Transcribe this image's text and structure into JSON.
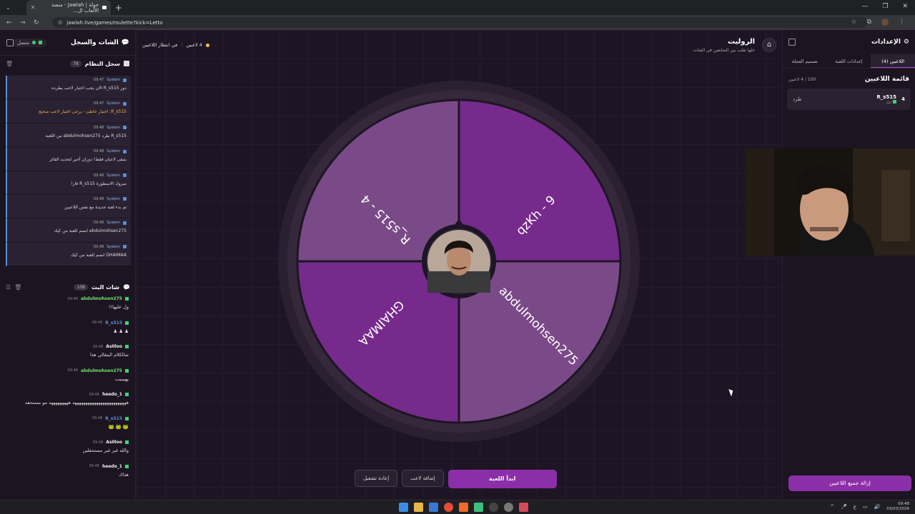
{
  "browser": {
    "tab_title": "جولة | Jawlah - منصة الألعاب ال...",
    "url": "jawlah.live/games/roulette?kick=Letto"
  },
  "left_panel": {
    "title": "الشات والسجل",
    "status": "متصل",
    "system_log": {
      "title": "سجل النظام",
      "count": "78",
      "items": [
        {
          "time": "09:47",
          "sender": "System",
          "text": "دور R_s515 الان يجب اختيار لاعب يطرده",
          "warn": false
        },
        {
          "time": "09:47",
          "sender": "System",
          "text": "R_s515: اختيار خاطئ - يرجى اختيار لاعب صحيح",
          "warn": true
        },
        {
          "time": "09:48",
          "sender": "System",
          "text": "R_s515 طرد abdulmohsen275 من اللعبة",
          "warn": false
        },
        {
          "time": "09:48",
          "sender": "System",
          "text": "بتبقى لاعبان فقط! دوران أخير لتحديد الفائز",
          "warn": false
        },
        {
          "time": "09:48",
          "sender": "System",
          "text": "مبروك الاسطورة R_s515 فاز!",
          "warn": false
        },
        {
          "time": "09:48",
          "sender": "System",
          "text": "تم بدء لعبة جديدة مع نفس اللاعبين",
          "warn": false
        },
        {
          "time": "09:48",
          "sender": "System",
          "text": "abdulmohsen275 انضم للعبة من كيك",
          "warn": false
        },
        {
          "time": "09:48",
          "sender": "System",
          "text": "GHAIMAA انضم للعبة من كيك",
          "warn": false
        }
      ]
    },
    "live_chat": {
      "title": "شات البث",
      "count": "108",
      "messages": [
        {
          "time": "09:48",
          "user": "abdulmohsen275",
          "color": "#6fe36a",
          "text": "ول عليها!!"
        },
        {
          "time": "09:48",
          "user": "R_s515",
          "color": "#5b8fd6",
          "text": "♟ ♟ ♟"
        },
        {
          "time": "09:48",
          "user": "As0loo",
          "color": "#f0f0f0",
          "text": "شالكلام البتقالي هذا"
        },
        {
          "time": "09:48",
          "user": "abdulmohsen275",
          "color": "#6fe36a",
          "text": "يهببببب"
        },
        {
          "time": "09:48",
          "user": "heedo_1",
          "color": "#f0f0f0",
          "text": "هههههههههههههههههههههههههه هههههههههه مو مستحقه"
        },
        {
          "time": "09:48",
          "user": "R_s515",
          "color": "#5b8fd6",
          "text": "🐸 🐸 🐸"
        },
        {
          "time": "09:48",
          "user": "As0loo",
          "color": "#f0f0f0",
          "text": "والله غير غير مستحقلين"
        },
        {
          "time": "09:48",
          "user": "heedo_1",
          "color": "#f0f0f0",
          "text": "هذاك"
        }
      ]
    }
  },
  "main": {
    "title": "الروليت",
    "subtitle": "خلها تقلب بين المتابعين في الشات",
    "players_count": "4 لاعبين",
    "waiting": "في انتظار اللاعبين",
    "wheel_segments": [
      {
        "label": "R_s515 - 4",
        "color": "#7a4a88"
      },
      {
        "label": "qzKh - 9",
        "color": "#762a8c"
      },
      {
        "label": "abdulmohsen275",
        "color": "#7a4a88"
      },
      {
        "label": "GHAIMAA",
        "color": "#762a8c"
      }
    ],
    "buttons": {
      "start": "ابدأ اللعبة",
      "add_player": "إضافة لاعب",
      "restart": "إعادة تشغيل"
    }
  },
  "right_panel": {
    "title": "الإعدادات",
    "tabs": [
      "اللاعبين (4)",
      "إعدادات اللعبة",
      "تصميم العجلة"
    ],
    "players_list_title": "قائمة اللاعبين",
    "players_capacity": "100 / 4 لاعبين",
    "player": {
      "num": "4",
      "name": "R_s515",
      "platform": "كيك",
      "kick_label": "طرد"
    },
    "remove_all": "إزالة جميع اللاعبين"
  },
  "taskbar": {
    "time": "09:48",
    "date": "03/03/2026",
    "lang": "ع"
  }
}
